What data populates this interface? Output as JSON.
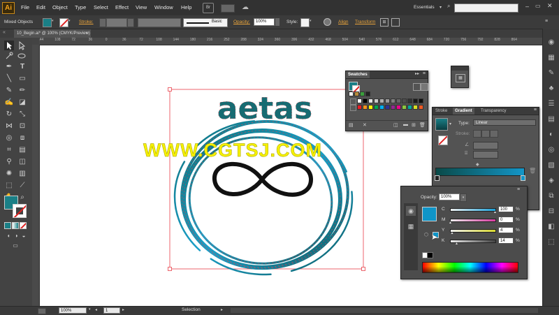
{
  "app": {
    "logo": "Ai",
    "workspace": "Essentials",
    "bridge": "Br"
  },
  "menu": [
    "File",
    "Edit",
    "Object",
    "Type",
    "Select",
    "Effect",
    "View",
    "Window",
    "Help"
  ],
  "control": {
    "selection": "Mixed Objects",
    "stroke_label": "Stroke:",
    "brush": "Basic",
    "opacity_label": "Opacity:",
    "opacity_value": "100%",
    "style_label": "Style:",
    "align": "Align",
    "transform": "Transform"
  },
  "document": {
    "tab": "10_Begin.ai* @ 100% (CMYK/Preview)",
    "close": "×"
  },
  "ruler": {
    "h": [
      "144",
      "108",
      "72",
      "36",
      "0",
      "36",
      "72",
      "108",
      "144",
      "180",
      "216",
      "252",
      "288",
      "324",
      "360",
      "396",
      "432",
      "468",
      "504",
      "540",
      "576",
      "612",
      "648",
      "684",
      "720",
      "756",
      "792",
      "828",
      "864"
    ]
  },
  "artwork": {
    "title": "aetas"
  },
  "watermark": "WWW.CGTSJ.COM",
  "swatches": {
    "title": "Swatches"
  },
  "gradient": {
    "tabs": [
      "Stroke",
      "Gradient",
      "Transparency"
    ],
    "type_label": "Type:",
    "type_value": "Linear",
    "stroke_label": "Stroke:"
  },
  "color_popup": {
    "opacity_label": "Opacity:",
    "opacity_value": "100%",
    "channels": [
      {
        "name": "C",
        "value": "100",
        "unit": "%",
        "color": "#1aa0d8",
        "level": 1.0
      },
      {
        "name": "M",
        "value": "0",
        "unit": "%",
        "color": "#d83aa0",
        "level": 0.0
      },
      {
        "name": "Y",
        "value": "4",
        "unit": "%",
        "color": "#d8d830",
        "level": 0.04
      },
      {
        "name": "K",
        "value": "14",
        "unit": "%",
        "color": "#444444",
        "level": 0.14
      }
    ],
    "swatch_color": "#0f95c8"
  },
  "status": {
    "zoom": "100%",
    "page": "1",
    "tool": "Selection"
  },
  "colors": {
    "teal": "#1a7f86",
    "dark_teal": "#115e65",
    "path": "#e8404a",
    "accent": "#e8a33a"
  }
}
